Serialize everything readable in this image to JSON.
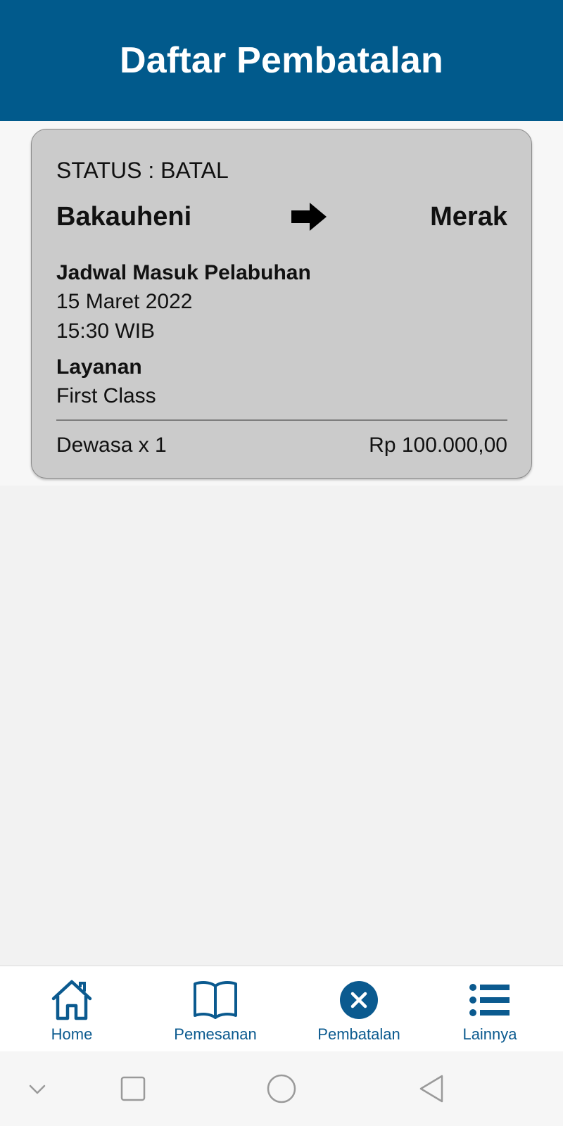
{
  "header": {
    "title": "Daftar Pembatalan"
  },
  "ticket": {
    "status_label": "STATUS : BATAL",
    "origin": "Bakauheni",
    "destination": "Merak",
    "schedule_label": "Jadwal Masuk Pelabuhan",
    "date": "15 Maret 2022",
    "time": "15:30 WIB",
    "service_label": "Layanan",
    "service_value": "First Class",
    "passenger": "Dewasa x 1",
    "price": "Rp 100.000,00"
  },
  "nav": {
    "items": [
      {
        "label": "Home",
        "icon": "home-icon"
      },
      {
        "label": "Pemesanan",
        "icon": "book-icon"
      },
      {
        "label": "Pembatalan",
        "icon": "cancel-circle-icon"
      },
      {
        "label": "Lainnya",
        "icon": "list-icon"
      }
    ]
  },
  "colors": {
    "primary": "#015a8c",
    "card_bg": "#cbcbcb",
    "page_bg": "#f2f2f2"
  }
}
